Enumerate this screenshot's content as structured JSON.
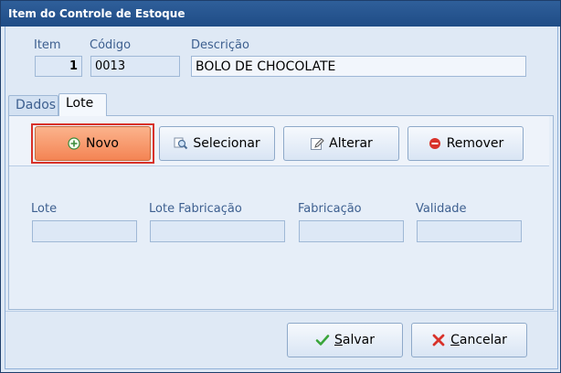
{
  "window": {
    "title": "Item do Controle de Estoque"
  },
  "header": {
    "item_label": "Item",
    "item_value": "1",
    "codigo_label": "Código",
    "codigo_value": "0013",
    "descricao_label": "Descrição",
    "descricao_value": "BOLO DE CHOCOLATE"
  },
  "tabs": [
    {
      "label": "Dados",
      "active": false
    },
    {
      "label": "Lote",
      "active": true
    }
  ],
  "toolbar": {
    "novo": "Novo",
    "selecionar": "Selecionar",
    "alterar": "Alterar",
    "remover": "Remover"
  },
  "lote_form": {
    "lote_label": "Lote",
    "lote_value": "",
    "lote_fabricacao_label": "Lote Fabricação",
    "lote_fabricacao_value": "",
    "fabricacao_label": "Fabricação",
    "fabricacao_value": "",
    "validade_label": "Validade",
    "validade_value": ""
  },
  "footer": {
    "salvar_first": "S",
    "salvar_rest": "alvar",
    "cancelar_first": "C",
    "cancelar_rest": "ancelar"
  },
  "colors": {
    "title_bar": "#1f4c86",
    "primary_button": "#f48454",
    "focus_border": "#d8322a",
    "label_text": "#3e6090",
    "save_check": "#3aa53a",
    "cancel_x": "#d8322a"
  },
  "icons": {
    "novo": "plus-circle-icon",
    "selecionar": "magnifier-icon",
    "alterar": "edit-pencil-icon",
    "remover": "minus-circle-icon",
    "salvar": "check-icon",
    "cancelar": "x-icon"
  }
}
